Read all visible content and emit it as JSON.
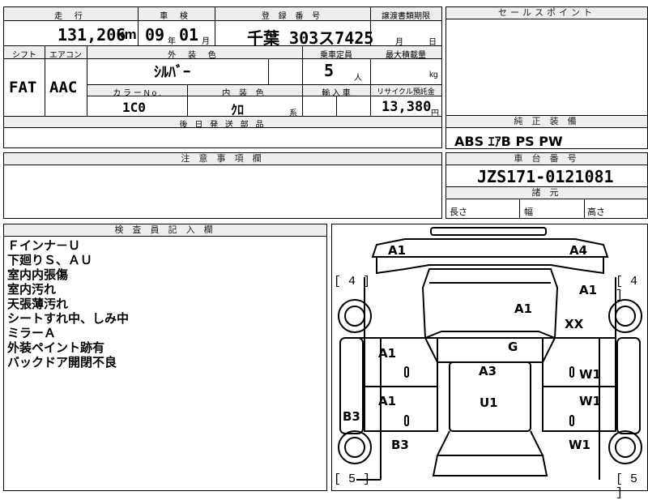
{
  "top_table": {
    "headers": {
      "mileage": "走 行",
      "inspection": "車 検",
      "registration": "登 録 番 号",
      "transfer_deadline": "譲渡書類期限",
      "shift": "シフト",
      "aircon": "エアコン",
      "exterior_color": "外 装 色",
      "capacity": "乗車定員",
      "max_load": "最大積載量",
      "color_no": "カ ラ ー N o .",
      "interior_color": "内 装 色",
      "import": "輸 入 車",
      "recycle": "リサイクル預託金",
      "later_parts": "後 日 発 送 部 品"
    },
    "mileage_value": "131,206",
    "mileage_unit": "km",
    "inspection_year": "09",
    "inspection_year_unit": "年",
    "inspection_month": "01",
    "inspection_month_unit": "月",
    "registration_value": "千葉 303ス7425",
    "transfer_month_unit": "月",
    "transfer_day_unit": "日",
    "shift_value": "FAT",
    "aircon_value": "AAC",
    "exterior_color_value": "ｼﾙﾊﾞｰ",
    "capacity_value": "5",
    "capacity_unit": "人",
    "max_load_unit": "kg",
    "color_no_value": "1C0",
    "interior_color_value": "ｸﾛ",
    "interior_color_unit": "系",
    "recycle_value": "13,380",
    "recycle_unit": "円"
  },
  "sales_point": {
    "header": "セールスポイント"
  },
  "equipment": {
    "header": "純 正 装 備",
    "value": "ABS ｴｱB PS PW"
  },
  "caution": {
    "header": "注 意 事 項 欄"
  },
  "chassis": {
    "header": "車 台 番 号",
    "value": "JZS171-0121081",
    "dims_header": "諸 元",
    "length_label": "長さ",
    "width_label": "幅",
    "height_label": "高さ"
  },
  "inspector": {
    "header": "検 査 員 記 入 欄",
    "notes": [
      "Ｆインナ－Ｕ",
      "下廻りＳ、ＡＵ",
      "室内内張傷",
      "室内汚れ",
      "天張薄汚れ",
      "シートすれ中、しみ中",
      "ミラーＡ",
      "外装ペイント跡有",
      "バックドア開閉不良"
    ]
  },
  "diagram": {
    "tire_left_top": "[ 4 ]",
    "tire_right_top": "[ 4 ]",
    "tire_left_bottom": "[ 5 ]",
    "tire_right_bottom": "[ 5 ]",
    "marks": {
      "front_left": "A1",
      "front_right": "A4",
      "fender_right": "A1",
      "hood": "A1",
      "right_front_wheel": "XX",
      "windshield": "G",
      "left_front_door": "A1",
      "roof": "A3",
      "right_front_door": "W1",
      "left_rear_door": "A1",
      "cabin": "U1",
      "right_rear_door": "W1",
      "left_rocker": "B3",
      "left_rear_quarter": "B3",
      "right_rear_quarter": "W1"
    }
  }
}
